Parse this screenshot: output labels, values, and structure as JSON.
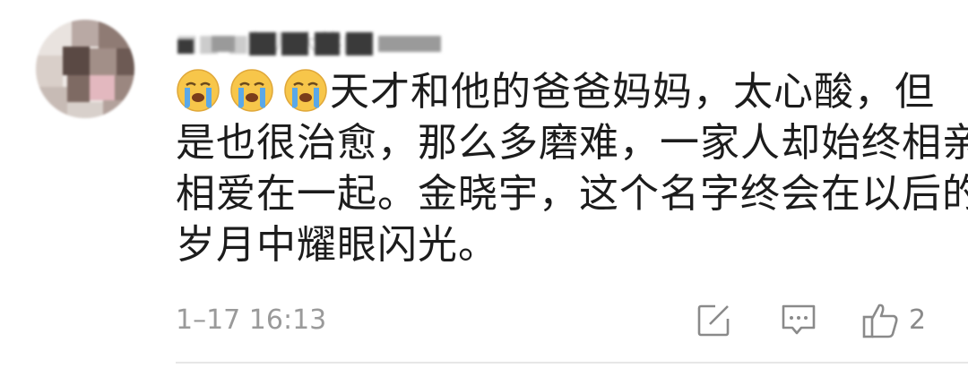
{
  "comment": {
    "username": "■■ ■舞儿大熊■",
    "emoji": [
      "crying-face",
      "crying-face",
      "crying-face"
    ],
    "lines": [
      "天才和他的爸爸妈妈，太心酸，但",
      "是也很治愈，那么多磨难，一家人却始终相亲",
      "相爱在一起。金晓宇，这个名字终会在以后的",
      "岁月中耀眼闪光。"
    ],
    "timestamp": "1–17 16:13",
    "actions": {
      "share_icon": "share-edit-icon",
      "reply_icon": "comment-icon",
      "like_icon": "thumbs-up-icon",
      "like_count": "2"
    }
  },
  "colors": {
    "text": "#1c1c1c",
    "meta": "#9a9a9a",
    "icon": "#8a8a8a",
    "emoji_face": "#f7c64a",
    "emoji_tear": "#5aa8e8"
  }
}
